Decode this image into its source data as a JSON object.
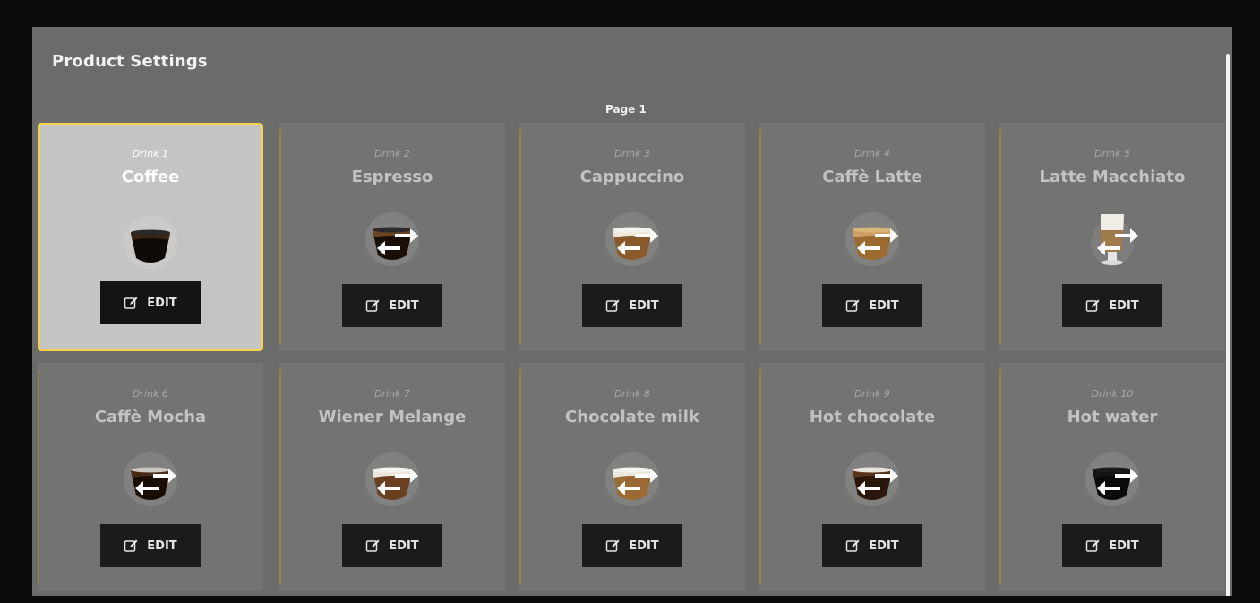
{
  "screen": {
    "title": "Product Settings",
    "page_label": "Page 1"
  },
  "drinks": [
    {
      "number": "Drink 1",
      "name": "Coffee",
      "cup": "coffee",
      "selected": true,
      "edit_label": "EDIT",
      "swap_icon": false
    },
    {
      "number": "Drink 2",
      "name": "Espresso",
      "cup": "espresso",
      "selected": false,
      "edit_label": "EDIT",
      "swap_icon": true
    },
    {
      "number": "Drink 3",
      "name": "Cappuccino",
      "cup": "cappuccino",
      "selected": false,
      "edit_label": "EDIT",
      "swap_icon": true
    },
    {
      "number": "Drink 4",
      "name": "Caffè Latte",
      "cup": "latte",
      "selected": false,
      "edit_label": "EDIT",
      "swap_icon": true
    },
    {
      "number": "Drink 5",
      "name": "Latte Macchiato",
      "cup": "macchiato",
      "selected": false,
      "edit_label": "EDIT",
      "swap_icon": true
    },
    {
      "number": "Drink 6",
      "name": "Caffè Mocha",
      "cup": "mocha",
      "selected": false,
      "edit_label": "EDIT",
      "swap_icon": true
    },
    {
      "number": "Drink 7",
      "name": "Wiener Melange",
      "cup": "melange",
      "selected": false,
      "edit_label": "EDIT",
      "swap_icon": true
    },
    {
      "number": "Drink 8",
      "name": "Chocolate milk",
      "cup": "chocmilk",
      "selected": false,
      "edit_label": "EDIT",
      "swap_icon": true
    },
    {
      "number": "Drink 9",
      "name": "Hot chocolate",
      "cup": "hotchoc",
      "selected": false,
      "edit_label": "EDIT",
      "swap_icon": true
    },
    {
      "number": "Drink 10",
      "name": "Hot water",
      "cup": "water",
      "selected": false,
      "edit_label": "EDIT",
      "swap_icon": true
    }
  ],
  "colors": {
    "accent_border": "#f2d34b",
    "divider": "#a88a2e",
    "screen_bg": "#6b6b69",
    "card_bg": "#737371",
    "selected_bg": "#c4c4c2",
    "button_bg": "#1b1b1b"
  },
  "icons": {
    "edit": "edit-icon",
    "swap": "swap-arrows-icon"
  }
}
